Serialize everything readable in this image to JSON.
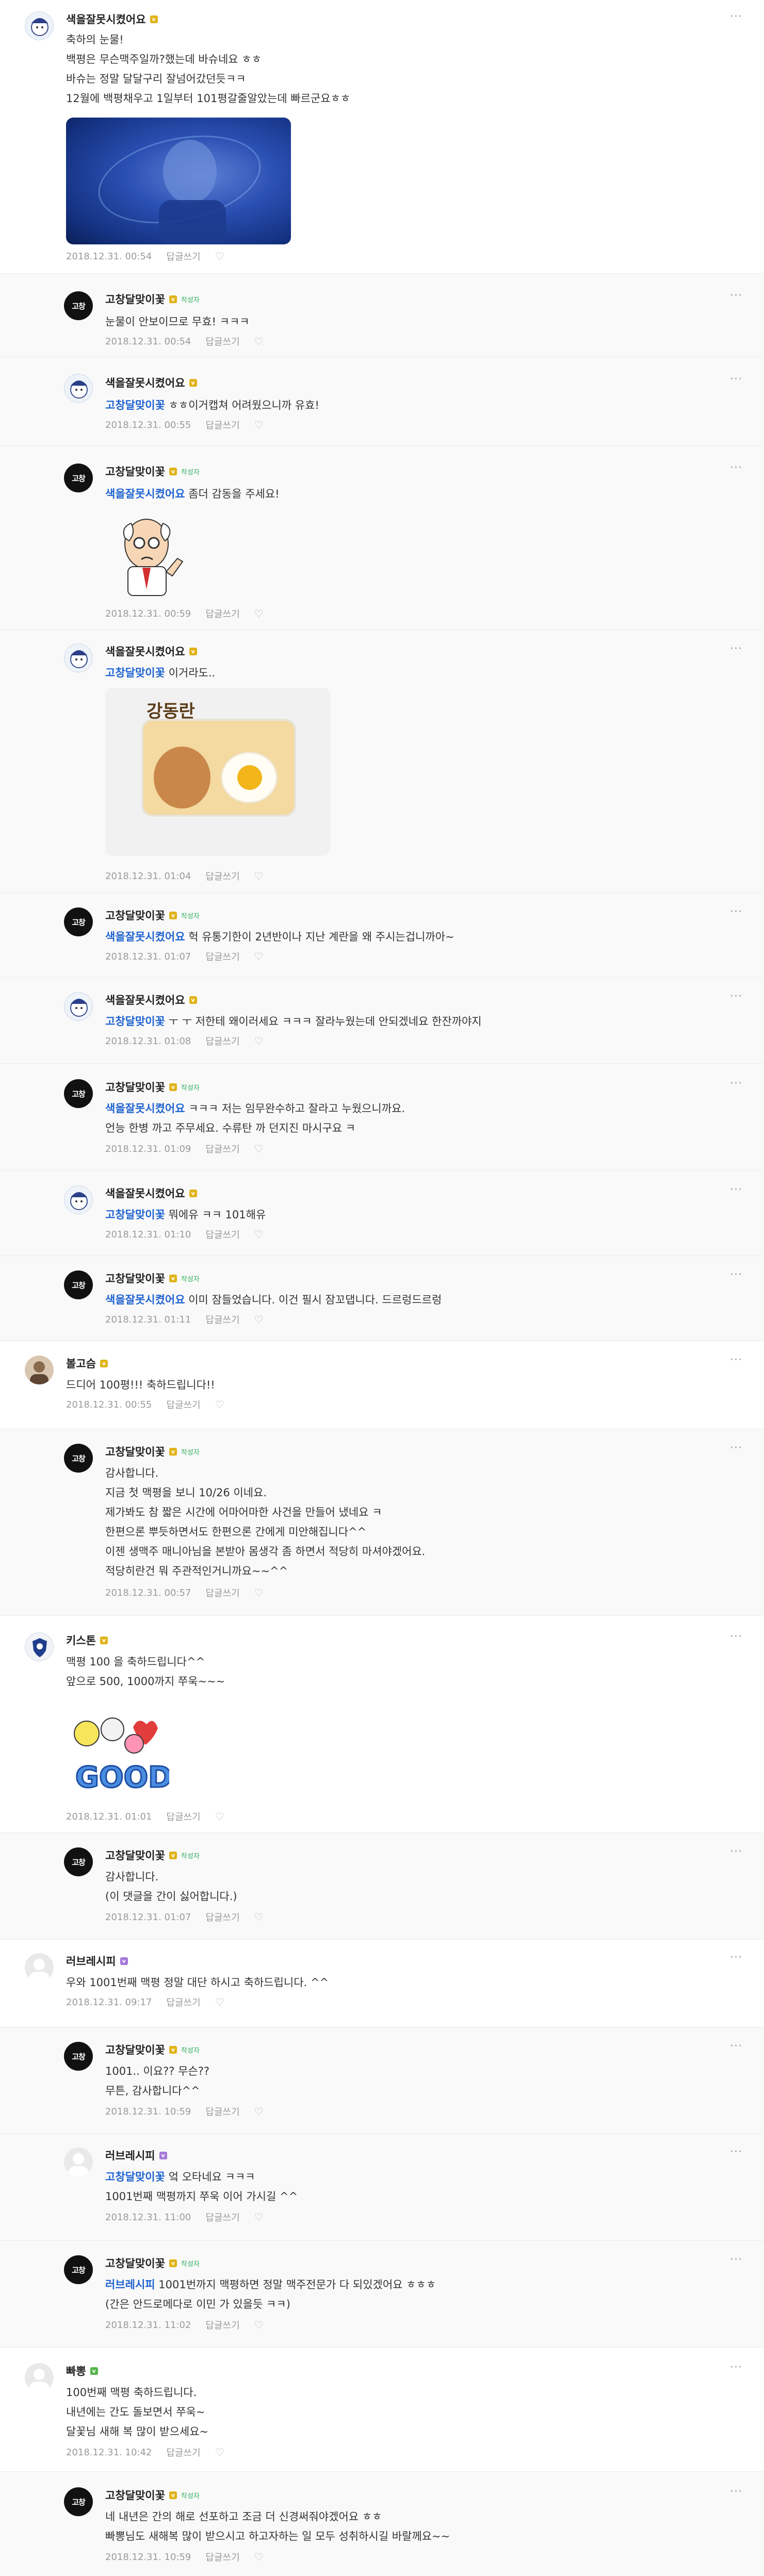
{
  "ui": {
    "more_label": "···",
    "reply_label": "답글쓰기",
    "writer_label": "작성자",
    "heart_icon": "♡",
    "badge_glyph": "v"
  },
  "comments": [
    {
      "id": "c1",
      "nick": "색을잘못시켰어요",
      "lines": [
        "축하의 눈물!",
        "백평은 무슨맥주일까?했는데 바슈네요 ㅎㅎ",
        "바슈는 정말 달달구리 잘넘어갔던듯ㅋㅋ",
        "12월에 백평채우고 1일부터 101평갈줄알았는데 빠르군요ㅎㅎ"
      ],
      "date": "2018.12.31. 00:54"
    },
    {
      "id": "c2",
      "nick": "고창달맞이꽃",
      "lines": [
        "눈물이 안보이므로 무효! ㅋㅋㅋ"
      ],
      "date": "2018.12.31. 00:54"
    },
    {
      "id": "c3",
      "nick": "색을잘못시켰어요",
      "mention": "고창달맞이꽃",
      "lines": [
        " ㅎㅎ이거캡쳐 어려웠으니까 유효!"
      ],
      "date": "2018.12.31. 00:55"
    },
    {
      "id": "c4",
      "nick": "고창달맞이꽃",
      "mention": "색을잘못시켰어요",
      "lines": [
        " 좀더 감동을 주세요!"
      ],
      "date": "2018.12.31. 00:59"
    },
    {
      "id": "c5",
      "nick": "색을잘못시켰어요",
      "mention": "고창달맞이꽃",
      "lines": [
        " 이거라도.."
      ],
      "date": "2018.12.31. 01:04",
      "photo_text": "강동란"
    },
    {
      "id": "c6",
      "nick": "고창달맞이꽃",
      "mention": "색을잘못시켰어요",
      "lines": [
        " 헉 유통기한이 2년반이나 지난 계란을 왜 주시는겁니까아~"
      ],
      "date": "2018.12.31. 01:07"
    },
    {
      "id": "c7",
      "nick": "색을잘못시켰어요",
      "mention": "고창달맞이꽃",
      "lines": [
        " ㅜ ㅜ 저한테 왜이러세요 ㅋㅋㅋ 잘라누웠는데 안되겠네요 한잔까야지"
      ],
      "date": "2018.12.31. 01:08"
    },
    {
      "id": "c8",
      "nick": "고창달맞이꽃",
      "mention": "색을잘못시켰어요",
      "lines": [
        " ㅋㅋㅋ 저는 임무완수하고 잘라고 누웠으니까요.",
        "언능 한병 까고 주무세요. 수류탄 까 던지진 마시구요 ㅋ"
      ],
      "date": "2018.12.31. 01:09"
    },
    {
      "id": "c9",
      "nick": "색을잘못시켰어요",
      "mention": "고창달맞이꽃",
      "lines": [
        " 뭐에유 ㅋㅋ 101해유"
      ],
      "date": "2018.12.31. 01:10"
    },
    {
      "id": "c10",
      "nick": "고창달맞이꽃",
      "mention": "색을잘못시켰어요",
      "lines": [
        " 이미 잠들었습니다. 이건 필시 잠꼬댑니다. 드르렁드르렁"
      ],
      "date": "2018.12.31. 01:11"
    },
    {
      "id": "c11",
      "nick": "볼고슴",
      "lines": [
        "드디어 100평!!! 축하드립니다!!"
      ],
      "date": "2018.12.31. 00:55"
    },
    {
      "id": "c12",
      "nick": "고창달맞이꽃",
      "lines": [
        "감사합니다.",
        "지금 첫 맥평을 보니 10/26 이네요.",
        "제가봐도 참 짧은 시간에 어마어마한 사건을 만들어 냈네요 ㅋ",
        "한편으론 뿌듯하면서도 한편으론 간에게 미안해집니다^^",
        "이젠 생맥주 매니아님을 본받아 몸생각 좀 하면서 적당히 마셔야겠어요.",
        "적당히란건 뭐 주관적인거니까요~~^^"
      ],
      "date": "2018.12.31. 00:57"
    },
    {
      "id": "c13",
      "nick": "키스톤",
      "lines": [
        "맥평 100 을 축하드립니다^^",
        "앞으로 500, 1000까지 쭈욱~~~"
      ],
      "date": "2018.12.31. 01:01",
      "sticker_text": "GOOD"
    },
    {
      "id": "c14",
      "nick": "고창달맞이꽃",
      "lines": [
        "감사합니다.",
        "(이 댓글을 간이 싫어합니다.)"
      ],
      "date": "2018.12.31. 01:07"
    },
    {
      "id": "c15",
      "nick": "러브레시피",
      "lines": [
        "우와 1001번째 맥평 정말 대단 하시고 축하드립니다. ^^"
      ],
      "date": "2018.12.31. 09:17"
    },
    {
      "id": "c16",
      "nick": "고창달맞이꽃",
      "lines": [
        "1001.. 이요?? 무슨??",
        "무튼, 감사합니다^^"
      ],
      "date": "2018.12.31. 10:59"
    },
    {
      "id": "c17",
      "nick": "러브레시피",
      "mention": "고창달맞이꽃",
      "lines": [
        " 엌 오타네요 ㅋㅋㅋ",
        "1001번째 맥평까지 쭈욱 이어 가시길 ^^"
      ],
      "date": "2018.12.31. 11:00"
    },
    {
      "id": "c18",
      "nick": "고창달맞이꽃",
      "mention": "러브레시피",
      "lines": [
        " 1001번까지 맥평하면 정말 맥주전문가 다 되있겠어요 ㅎㅎㅎ",
        "(간은 안드로메다로 이민 가 있을듯 ㅋㅋ)"
      ],
      "date": "2018.12.31. 11:02"
    },
    {
      "id": "c19",
      "nick": "빠뽕",
      "lines": [
        "100번째 맥평 축하드립니다.",
        "내년에는 간도 돌보면서 쭈욱~",
        "달꽃님 새해 복 많이 받으세요~"
      ],
      "date": "2018.12.31. 10:42"
    },
    {
      "id": "c20",
      "nick": "고창달맞이꽃",
      "lines": [
        "네 내년은 간의 해로 선포하고 조금 더 신경써줘야겠어요 ㅎㅎ",
        "빠뽕님도 새해복 많이 받으시고 하고자하는 일 모두 성취하시길 바랄께요~~"
      ],
      "date": "2018.12.31. 10:59"
    }
  ]
}
